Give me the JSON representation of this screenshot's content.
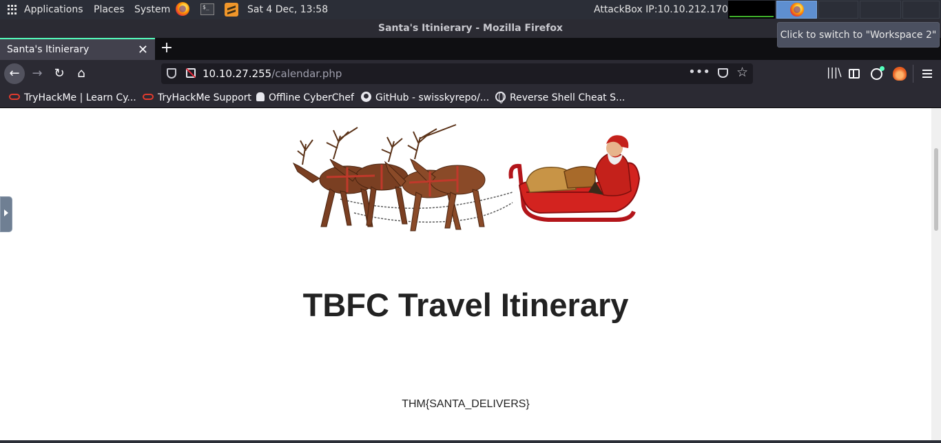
{
  "top_panel": {
    "applications": "Applications",
    "places": "Places",
    "system": "System",
    "datetime": "Sat  4 Dec, 13:58",
    "attackbox_ip": "AttackBox IP:10.10.212.170",
    "tooltip": "Click to switch to \"Workspace 2\""
  },
  "window": {
    "title": "Santa's Itinierary - Mozilla Firefox"
  },
  "tabs": [
    {
      "label": "Santa's Itinierary"
    }
  ],
  "navbar": {
    "url_host": "10.10.27.255",
    "url_path": "/calendar.php"
  },
  "bookmarks": [
    {
      "label": "TryHackMe | Learn Cy...",
      "icon": "cloud-icon"
    },
    {
      "label": "TryHackMe Support",
      "icon": "cloud-icon"
    },
    {
      "label": "Offline CyberChef",
      "icon": "chef-icon"
    },
    {
      "label": "GitHub - swisskyrepo/...",
      "icon": "github-icon"
    },
    {
      "label": "Reverse Shell Cheat S...",
      "icon": "globe-icon"
    }
  ],
  "page": {
    "heading": "TBFC Travel Itinerary",
    "flag": "THM{SANTA_DELIVERS}"
  },
  "colors": {
    "accent_tab": "#54ffbd",
    "insecure_slash": "#e2293a",
    "panel_bg": "#2b2e37",
    "workspace_active": "#5e8fd0"
  }
}
